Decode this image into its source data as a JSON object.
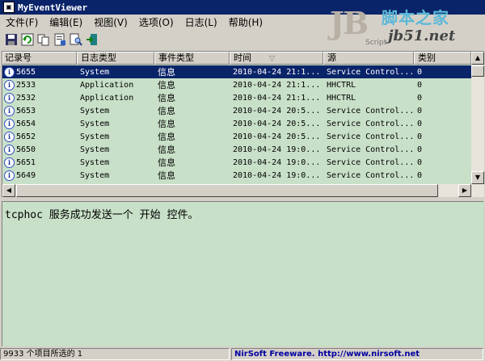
{
  "window": {
    "title": "MyEventViewer"
  },
  "menu": [
    "文件(F)",
    "编辑(E)",
    "视图(V)",
    "选项(O)",
    "日志(L)",
    "帮助(H)"
  ],
  "toolbar_icons": [
    "save-icon",
    "refresh-icon",
    "copy-icon",
    "properties-icon",
    "find-icon",
    "exit-icon"
  ],
  "watermark": {
    "logo": "JB",
    "script": "Script",
    "cn": "脚本之家",
    "url": "jb51.net"
  },
  "table": {
    "columns": [
      "记录号",
      "日志类型",
      "事件类型",
      "时间",
      "源",
      "类别"
    ],
    "sort_column": "时间",
    "rows": [
      {
        "id": "5655",
        "log": "System",
        "type": "信息",
        "time": "2010-04-24 21:1...",
        "source": "Service Control...",
        "category": "0",
        "selected": true
      },
      {
        "id": "2533",
        "log": "Application",
        "type": "信息",
        "time": "2010-04-24 21:1...",
        "source": "HHCTRL",
        "category": "0"
      },
      {
        "id": "2532",
        "log": "Application",
        "type": "信息",
        "time": "2010-04-24 21:1...",
        "source": "HHCTRL",
        "category": "0"
      },
      {
        "id": "5653",
        "log": "System",
        "type": "信息",
        "time": "2010-04-24 20:5...",
        "source": "Service Control...",
        "category": "0"
      },
      {
        "id": "5654",
        "log": "System",
        "type": "信息",
        "time": "2010-04-24 20:5...",
        "source": "Service Control...",
        "category": "0"
      },
      {
        "id": "5652",
        "log": "System",
        "type": "信息",
        "time": "2010-04-24 20:5...",
        "source": "Service Control...",
        "category": "0"
      },
      {
        "id": "5650",
        "log": "System",
        "type": "信息",
        "time": "2010-04-24 19:0...",
        "source": "Service Control...",
        "category": "0"
      },
      {
        "id": "5651",
        "log": "System",
        "type": "信息",
        "time": "2010-04-24 19:0...",
        "source": "Service Control...",
        "category": "0"
      },
      {
        "id": "5649",
        "log": "System",
        "type": "信息",
        "time": "2010-04-24 19:0...",
        "source": "Service Control...",
        "category": "0"
      }
    ]
  },
  "detail": {
    "text": "tcphoc 服务成功发送一个 开始 控件。"
  },
  "status": {
    "count": "9933 个项目所选的 1",
    "credit": "NirSoft Freeware.  http://www.nirsoft.net"
  },
  "colors": {
    "titlebar": "#0a246a",
    "list_bg": "#c8e0c8",
    "selection": "#0a246a"
  }
}
